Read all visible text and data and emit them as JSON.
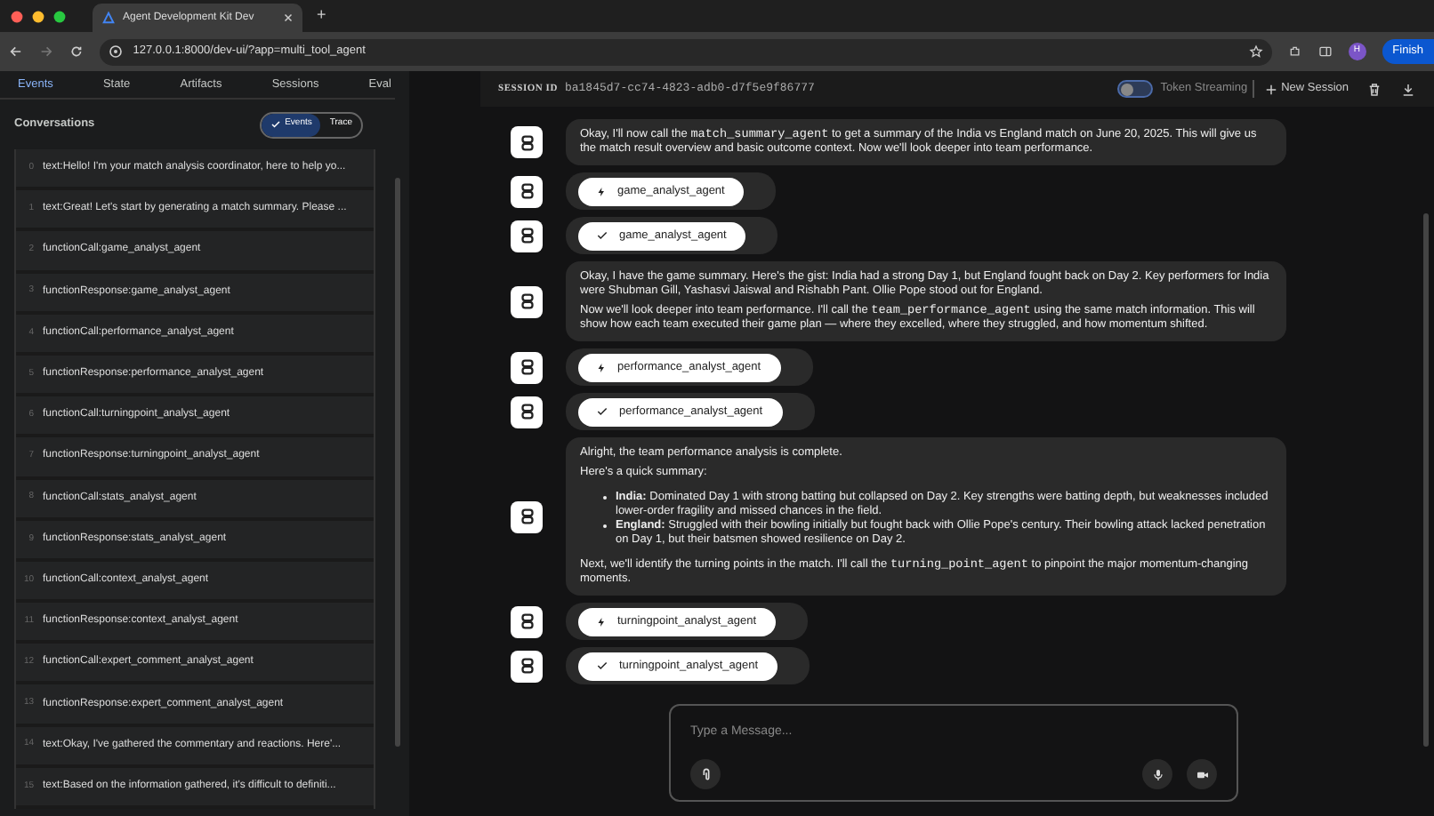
{
  "browser": {
    "tab_title": "Agent Development Kit Dev",
    "new_tab": "+",
    "url": "127.0.0.1:8000/dev-ui/?app=multi_tool_agent",
    "profile": "H",
    "finish_button": "Finish"
  },
  "sidebar": {
    "tabs": [
      {
        "label": "Events",
        "selected": true
      },
      {
        "label": "State",
        "selected": false
      },
      {
        "label": "Artifacts",
        "selected": false
      },
      {
        "label": "Sessions",
        "selected": false
      },
      {
        "label": "Eval",
        "selected": false
      }
    ],
    "conversations_label": "Conversations",
    "view_toggle": [
      {
        "label": "Events",
        "selected": true
      },
      {
        "label": "Trace",
        "selected": false
      }
    ],
    "events": [
      {
        "index": "0",
        "text": "text:Hello! I'm your match analysis coordinator, here to help yo..."
      },
      {
        "index": "1",
        "text": "text:Great! Let's start by generating a match summary. Please ..."
      },
      {
        "index": "2",
        "text": "functionCall:game_analyst_agent"
      },
      {
        "index": "3",
        "text": "functionResponse:game_analyst_agent"
      },
      {
        "index": "4",
        "text": "functionCall:performance_analyst_agent"
      },
      {
        "index": "5",
        "text": "functionResponse:performance_analyst_agent"
      },
      {
        "index": "6",
        "text": "functionCall:turningpoint_analyst_agent"
      },
      {
        "index": "7",
        "text": "functionResponse:turningpoint_analyst_agent"
      },
      {
        "index": "8",
        "text": "functionCall:stats_analyst_agent"
      },
      {
        "index": "9",
        "text": "functionResponse:stats_analyst_agent"
      },
      {
        "index": "10",
        "text": "functionCall:context_analyst_agent"
      },
      {
        "index": "11",
        "text": "functionResponse:context_analyst_agent"
      },
      {
        "index": "12",
        "text": "functionCall:expert_comment_analyst_agent"
      },
      {
        "index": "13",
        "text": "functionResponse:expert_comment_analyst_agent"
      },
      {
        "index": "14",
        "text": "text:Okay, I've gathered the commentary and reactions. Here'..."
      },
      {
        "index": "15",
        "text": "text:Based on the information gathered, it's difficult to definiti..."
      }
    ]
  },
  "header": {
    "session_label": "SESSION ID",
    "session_id": "ba1845d7-cc74-4823-adb0-d7f5e9f86777",
    "token_streaming": {
      "label": "Token Streaming",
      "on": false
    },
    "new_session": "New Session"
  },
  "messages": [
    {
      "kind": "text",
      "blocks": [
        {
          "kind": "paragraph",
          "parts": [
            {
              "text": "Okay, I'll now call the ",
              "code": false
            },
            {
              "text": "match_summary_agent",
              "code": true
            },
            {
              "text": " to get a summary of the India vs England match on June 20, 2025. This will give us the match result overview and basic outcome context. Now we'll look deeper into team performance.",
              "code": false
            }
          ]
        }
      ]
    },
    {
      "kind": "call",
      "agent": "game_analyst_agent"
    },
    {
      "kind": "response",
      "agent": "game_analyst_agent"
    },
    {
      "kind": "text",
      "blocks": [
        {
          "kind": "paragraph",
          "parts": [
            {
              "text": "Okay, I have the game summary. Here's the gist: India had a strong Day 1, but England fought back on Day 2. Key performers for India were Shubman Gill, Yashasvi Jaiswal and Rishabh Pant. Ollie Pope stood out for England.",
              "code": false
            }
          ]
        },
        {
          "kind": "paragraph",
          "parts": [
            {
              "text": "Now we'll look deeper into team performance. I'll call the ",
              "code": false
            },
            {
              "text": "team_performance_agent",
              "code": true
            },
            {
              "text": " using the same match information. This will show how each team executed their game plan — where they excelled, where they struggled, and how momentum shifted.",
              "code": false
            }
          ]
        }
      ]
    },
    {
      "kind": "call",
      "agent": "performance_analyst_agent"
    },
    {
      "kind": "response",
      "agent": "performance_analyst_agent"
    },
    {
      "kind": "text",
      "blocks": [
        {
          "kind": "paragraph",
          "parts": [
            {
              "text": "Alright, the team performance analysis is complete.",
              "code": false
            }
          ]
        },
        {
          "kind": "paragraph",
          "parts": [
            {
              "text": "Here's a quick summary:",
              "code": false
            }
          ]
        },
        {
          "kind": "list",
          "items": [
            "**India:** Dominated Day 1 with strong batting but collapsed on Day 2. Key strengths were batting depth, but weaknesses included lower-order fragility and missed chances in the field.",
            "**England:** Struggled with their bowling initially but fought back with Ollie Pope's century. Their bowling attack lacked penetration on Day 1, but their batsmen showed resilience on Day 2."
          ]
        },
        {
          "kind": "paragraph",
          "parts": [
            {
              "text": "Next, we'll identify the turning points in the match. I'll call the ",
              "code": false
            },
            {
              "text": "turning_point_agent",
              "code": true
            },
            {
              "text": " to pinpoint the major momentum-changing moments.",
              "code": false
            }
          ]
        }
      ]
    },
    {
      "kind": "call",
      "agent": "turningpoint_analyst_agent"
    },
    {
      "kind": "response",
      "agent": "turningpoint_analyst_agent"
    }
  ],
  "composer": {
    "placeholder": "Type a Message..."
  }
}
